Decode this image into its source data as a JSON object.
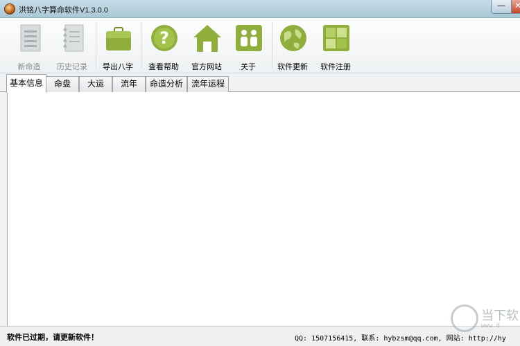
{
  "window": {
    "title": "洪铭八字算命软件V1.3.0.0",
    "minimize_glyph": "—",
    "close_glyph": "✕"
  },
  "toolbar": {
    "items": [
      {
        "label": "新命造",
        "icon": "document-icon",
        "enabled": false
      },
      {
        "label": "历史记录",
        "icon": "notebook-icon",
        "enabled": false
      },
      {
        "label": "导出八字",
        "icon": "briefcase-icon",
        "enabled": true
      },
      {
        "label": "查看帮助",
        "icon": "help-icon",
        "enabled": true
      },
      {
        "label": "官方网站",
        "icon": "home-icon",
        "enabled": true
      },
      {
        "label": "关于",
        "icon": "about-icon",
        "enabled": true
      },
      {
        "label": "软件更新",
        "icon": "globe-icon",
        "enabled": true
      },
      {
        "label": "软件注册",
        "icon": "register-icon",
        "enabled": true
      }
    ]
  },
  "tabs": [
    {
      "label": "基本信息",
      "active": true
    },
    {
      "label": "命盘",
      "active": false
    },
    {
      "label": "大运",
      "active": false
    },
    {
      "label": "流年",
      "active": false
    },
    {
      "label": "命造分析",
      "active": false
    },
    {
      "label": "流年运程",
      "active": false
    }
  ],
  "status": {
    "left": "软件已过期，请更新软件！",
    "right": "QQ: 1507156415, 联系: hybzsm@qq.com, 网站: http://hy"
  },
  "watermark": {
    "text": "当下软",
    "sub": "www.d"
  },
  "colors": {
    "accent_green": "#8fae3c",
    "disabled_gray": "#b8bdbf"
  }
}
